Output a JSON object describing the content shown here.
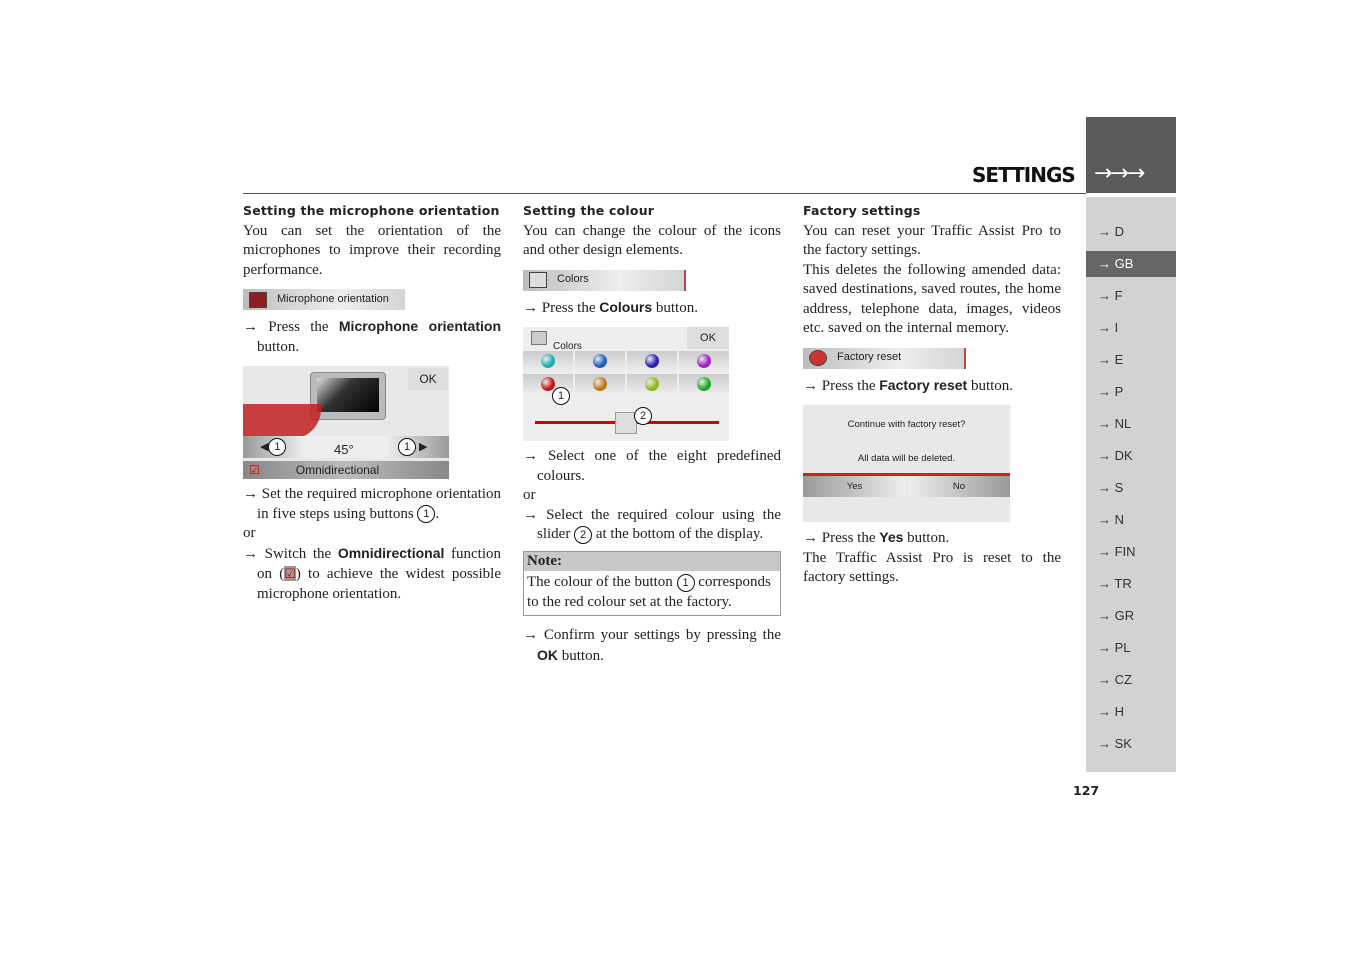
{
  "header": {
    "title": "SETTINGS",
    "arrows": "→→→",
    "page_number": "127"
  },
  "sidebar": {
    "items": [
      {
        "label": "→ D"
      },
      {
        "label": "→ GB",
        "active": true
      },
      {
        "label": "→ F"
      },
      {
        "label": "→ I"
      },
      {
        "label": "→ E"
      },
      {
        "label": "→ P"
      },
      {
        "label": "→ NL"
      },
      {
        "label": "→ DK"
      },
      {
        "label": "→ S"
      },
      {
        "label": "→ N"
      },
      {
        "label": "→ FIN"
      },
      {
        "label": "→ TR"
      },
      {
        "label": "→ GR"
      },
      {
        "label": "→ PL"
      },
      {
        "label": "→ CZ"
      },
      {
        "label": "→ H"
      },
      {
        "label": "→ SK"
      }
    ]
  },
  "col1": {
    "heading": "Setting the microphone orientation",
    "intro": "You can set the orientation of the microphones to improve their recording performance.",
    "button": "Microphone orientation",
    "step1_pre": "→ Press the ",
    "step1_bold": "Microphone orientation",
    "step1_post": " button.",
    "screen": {
      "ok": "OK",
      "angle": "45°",
      "omni": "Omnidirectional",
      "callout": "1"
    },
    "step2_pre": "→ Set the required microphone orientation in five steps using buttons ",
    "step2_post": ".",
    "or": "or",
    "step3_pre": "→ Switch the ",
    "step3_bold": "Omnidirectional",
    "step3_mid": " function on (",
    "step3_post": ") to achieve the widest possible microphone orientation."
  },
  "col2": {
    "heading": "Setting the colour",
    "intro": "You can change the colour of the icons and other design elements.",
    "button": "Colors",
    "step1_pre": "→ Press the ",
    "step1_bold": "Colours",
    "step1_post": " button.",
    "screen": {
      "title": "Colors",
      "ok": "OK",
      "callout1": "1",
      "callout2": "2"
    },
    "colors": [
      "#20b0b0",
      "#2060c0",
      "#3020b0",
      "#a020c0",
      "#c01818",
      "#c07818",
      "#90b818",
      "#20a820"
    ],
    "step2": "→ Select one of the eight predefined colours.",
    "or": "or",
    "step3_pre": "→ Select the required colour using the slider ",
    "step3_post": " at the bottom of the display.",
    "note_head": "Note:",
    "note_pre": "The colour of the button ",
    "note_post": " corresponds to the red colour set at the factory.",
    "step4_pre": "→ Confirm your settings by pressing the ",
    "step4_bold": "OK",
    "step4_post": " button."
  },
  "col3": {
    "heading": "Factory settings",
    "intro": "You can reset your Traffic Assist Pro to the factory settings.",
    "intro2": "This deletes the following amended data: saved destinations, saved routes, the home address, telephone data, images, videos etc. saved on the internal memory.",
    "button": "Factory reset",
    "step1_pre": "→ Press the ",
    "step1_bold": "Factory reset",
    "step1_post": " button.",
    "dialog": {
      "question": "Continue with factory reset?",
      "warning": "All data will be deleted.",
      "yes": "Yes",
      "no": "No"
    },
    "step2_pre": "→ Press the ",
    "step2_bold": "Yes",
    "step2_post": " button.",
    "result": "The Traffic Assist Pro is reset to the factory settings."
  }
}
